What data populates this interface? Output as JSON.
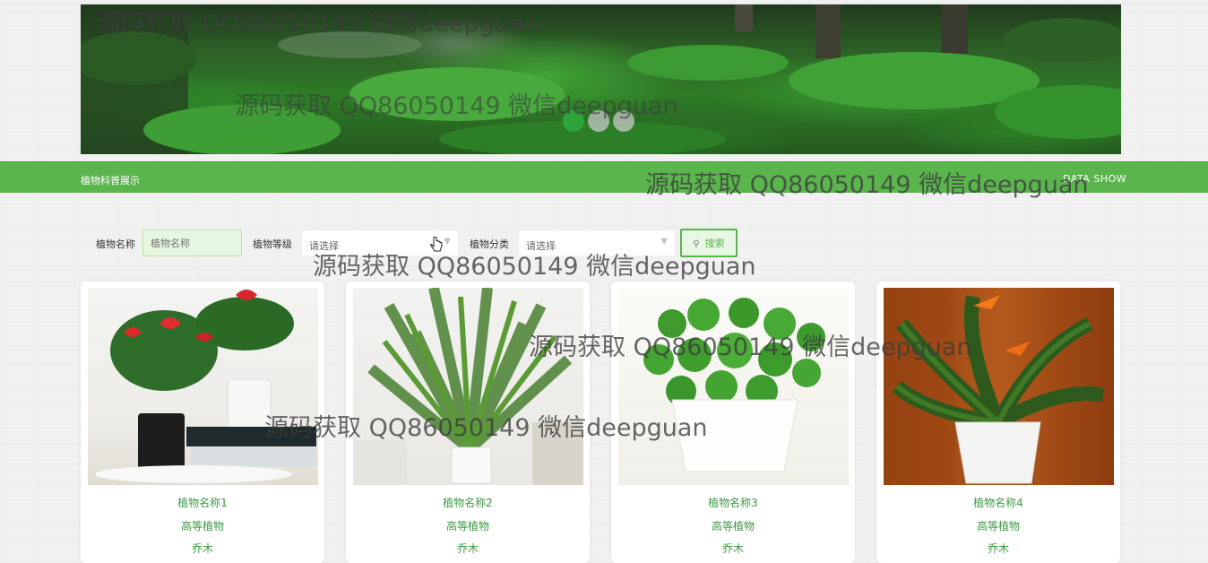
{
  "navbar": {
    "title": "植物科普展示",
    "right": "DATA SHOW"
  },
  "search": {
    "name_label": "植物名称",
    "name_placeholder": "植物名称",
    "level_label": "植物等级",
    "level_value": "请选择",
    "category_label": "植物分类",
    "category_value": "请选择",
    "button": "搜索"
  },
  "cards": [
    {
      "name": "植物名称1",
      "level": "高等植物",
      "category": "乔木"
    },
    {
      "name": "植物名称2",
      "level": "高等植物",
      "category": "乔木"
    },
    {
      "name": "植物名称3",
      "level": "高等植物",
      "category": "乔木"
    },
    {
      "name": "植物名称4",
      "level": "高等植物",
      "category": "乔木"
    }
  ],
  "carousel": {
    "slides": 3,
    "active": 1,
    "active_color": "#2fa43a"
  },
  "watermark": "源码获取 QQ86050149 微信deepguan",
  "colors": {
    "accent": "#5bb54d",
    "text_green": "#3d9a45"
  }
}
